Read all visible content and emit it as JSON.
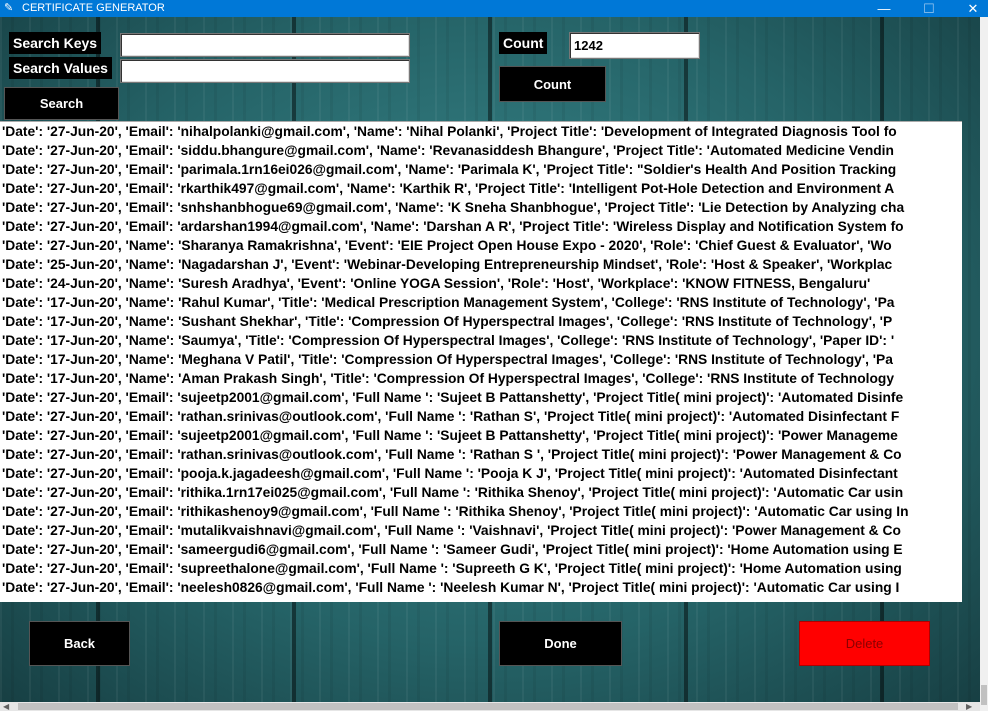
{
  "window": {
    "title": "CERTIFICATE GENERATOR",
    "minimize_glyph": "—",
    "maximize_glyph": "☐",
    "close_glyph": "✕"
  },
  "search": {
    "keys_label": "Search Keys",
    "values_label": "Search Values",
    "keys_value": "",
    "values_value": "",
    "button_label": "Search"
  },
  "count": {
    "label": "Count",
    "value": "1242",
    "button_label": "Count"
  },
  "records": [
    "'Date': '27-Jun-20', 'Email': 'nihalpolanki@gmail.com', 'Name': 'Nihal Polanki', 'Project Title': 'Development of Integrated Diagnosis Tool fo",
    "'Date': '27-Jun-20', 'Email': 'siddu.bhangure@gmail.com', 'Name': 'Revanasiddesh Bhangure', 'Project Title': 'Automated Medicine Vendin",
    "'Date': '27-Jun-20', 'Email': 'parimala.1rn16ei026@gmail.com', 'Name': 'Parimala K', 'Project Title': \"Soldier's Health And Position Tracking",
    "'Date': '27-Jun-20', 'Email': 'rkarthik497@gmail.com', 'Name': 'Karthik R', 'Project Title': 'Intelligent Pot-Hole Detection and Environment A",
    "'Date': '27-Jun-20', 'Email': 'snhshanbhogue69@gmail.com', 'Name': 'K Sneha Shanbhogue', 'Project Title': 'Lie Detection by Analyzing cha",
    "'Date': '27-Jun-20', 'Email': 'ardarshan1994@gmail.com', 'Name': 'Darshan A R', 'Project Title': 'Wireless Display and Notification System fo",
    "'Date': '27-Jun-20', 'Name': 'Sharanya Ramakrishna', 'Event': 'EIE Project Open House Expo - 2020', 'Role': 'Chief Guest & Evaluator', 'Wo",
    "'Date': '25-Jun-20', 'Name': 'Nagadarshan J', 'Event': 'Webinar-Developing Entrepreneurship Mindset', 'Role': 'Host & Speaker', 'Workplac",
    "'Date': '24-Jun-20', 'Name': 'Suresh Aradhya', 'Event': 'Online YOGA Session', 'Role': 'Host', 'Workplace': 'KNOW FITNESS, Bengaluru'",
    "'Date': '17-Jun-20', 'Name': 'Rahul Kumar', 'Title': 'Medical Prescription Management System', 'College': 'RNS Institute of Technology', 'Pa",
    "'Date': '17-Jun-20', 'Name': 'Sushant Shekhar', 'Title': 'Compression Of Hyperspectral Images', 'College': 'RNS Institute of Technology', 'P",
    "'Date': '17-Jun-20', 'Name': 'Saumya', 'Title': 'Compression Of Hyperspectral Images', 'College': 'RNS Institute of Technology', 'Paper ID': '",
    "'Date': '17-Jun-20', 'Name': 'Meghana V Patil', 'Title': 'Compression Of Hyperspectral Images', 'College': 'RNS Institute of Technology', 'Pa",
    "'Date': '17-Jun-20', 'Name': 'Aman Prakash Singh', 'Title': 'Compression Of Hyperspectral Images', 'College': 'RNS Institute of Technology",
    "'Date': '27-Jun-20', 'Email': 'sujeetp2001@gmail.com', 'Full Name ': 'Sujeet B Pattanshetty', 'Project Title( mini project)': 'Automated Disinfe",
    "'Date': '27-Jun-20', 'Email': 'rathan.srinivas@outlook.com', 'Full Name ': 'Rathan S', 'Project Title( mini project)': 'Automated Disinfectant F",
    "'Date': '27-Jun-20', 'Email': 'sujeetp2001@gmail.com', 'Full Name ': 'Sujeet B Pattanshetty', 'Project Title( mini project)': 'Power Manageme",
    "'Date': '27-Jun-20', 'Email': 'rathan.srinivas@outlook.com', 'Full Name ': 'Rathan S ', 'Project Title( mini project)': 'Power Management & Co",
    "'Date': '27-Jun-20', 'Email': 'pooja.k.jagadeesh@gmail.com', 'Full Name ': 'Pooja K J', 'Project Title( mini project)': 'Automated Disinfectant",
    "'Date': '27-Jun-20', 'Email': 'rithika.1rn17ei025@gmail.com', 'Full Name ': 'Rithika Shenoy', 'Project Title( mini project)': 'Automatic Car usin",
    "'Date': '27-Jun-20', 'Email': 'rithikashenoy9@gmail.com', 'Full Name ': 'Rithika Shenoy', 'Project Title( mini project)': 'Automatic Car using In",
    "'Date': '27-Jun-20', 'Email': 'mutalikvaishnavi@gmail.com', 'Full Name ': 'Vaishnavi', 'Project Title( mini project)': 'Power Management & Co",
    "'Date': '27-Jun-20', 'Email': 'sameergudi6@gmail.com', 'Full Name ': 'Sameer Gudi', 'Project Title( mini project)': 'Home Automation using E",
    "'Date': '27-Jun-20', 'Email': 'supreethalone@gmail.com', 'Full Name ': 'Supreeth G K', 'Project Title( mini project)': 'Home Automation using",
    "'Date': '27-Jun-20', 'Email': 'neelesh0826@gmail.com', 'Full Name ': 'Neelesh Kumar N', 'Project Title( mini project)': 'Automatic Car using I"
  ],
  "actions": {
    "back_label": "Back",
    "done_label": "Done",
    "delete_label": "Delete"
  },
  "colors": {
    "titlebar": "#0078d7",
    "delete_bg": "#ff0000",
    "delete_text": "#8b0000",
    "background": "#2a6d72"
  }
}
